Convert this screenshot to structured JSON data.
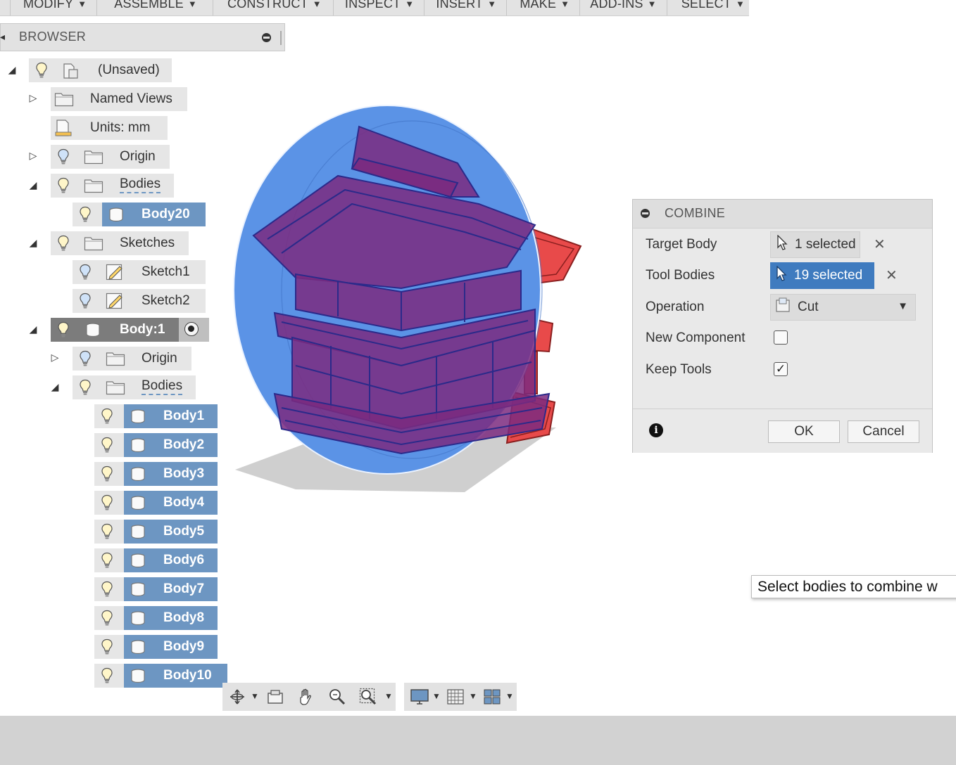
{
  "menu": {
    "items": [
      {
        "label": "MODIFY"
      },
      {
        "label": "ASSEMBLE"
      },
      {
        "label": "CONSTRUCT"
      },
      {
        "label": "INSPECT"
      },
      {
        "label": "INSERT"
      },
      {
        "label": "MAKE"
      },
      {
        "label": "ADD-INS"
      },
      {
        "label": "SELECT"
      }
    ]
  },
  "browser": {
    "title": "BROWSER",
    "tree": {
      "root": "(Unsaved)",
      "named_views": "Named Views",
      "units": "Units: mm",
      "origin": "Origin",
      "bodies": "Bodies",
      "body20": "Body20",
      "sketches": "Sketches",
      "sketch1": "Sketch1",
      "sketch2": "Sketch2",
      "component": "Body:1",
      "comp_origin": "Origin",
      "comp_bodies": "Bodies",
      "comp_body_items": [
        "Body1",
        "Body2",
        "Body3",
        "Body4",
        "Body5",
        "Body6",
        "Body7",
        "Body8",
        "Body9",
        "Body10"
      ]
    }
  },
  "dialog": {
    "title": "COMBINE",
    "target_body_label": "Target Body",
    "target_body_value": "1 selected",
    "tool_bodies_label": "Tool Bodies",
    "tool_bodies_value": "19 selected",
    "operation_label": "Operation",
    "operation_value": "Cut",
    "new_component_label": "New Component",
    "new_component_checked": false,
    "keep_tools_label": "Keep Tools",
    "keep_tools_checked": true,
    "ok_label": "OK",
    "cancel_label": "Cancel"
  },
  "tooltip": "Select bodies to combine w",
  "colors": {
    "selection_blue": "#6d96c2",
    "active_button": "#3f7bbf",
    "sphere_blue": "#5b93e6",
    "building_purple": "#7b2a7f",
    "building_red": "#e23b3b"
  }
}
